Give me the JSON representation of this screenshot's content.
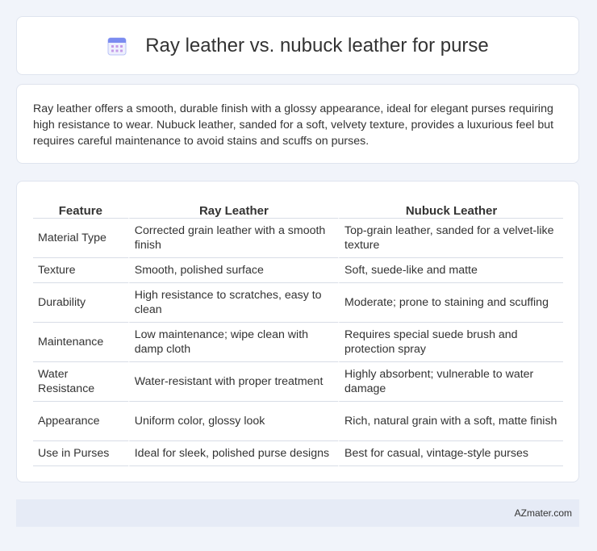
{
  "page": {
    "title": "Ray leather vs. nubuck leather for purse",
    "title_icon": "calendar-icon",
    "summary": "Ray leather offers a smooth, durable finish with a glossy appearance, ideal for elegant purses requiring high resistance to wear. Nubuck leather, sanded for a soft, velvety texture, provides a luxurious feel but requires careful maintenance to avoid stains and scuffs on purses.",
    "footer": "AZmater.com"
  },
  "table": {
    "headers": [
      "Feature",
      "Ray Leather",
      "Nubuck Leather"
    ],
    "rows": [
      [
        "Material Type",
        "Corrected grain leather with a smooth finish",
        "Top-grain leather, sanded for a velvet-like texture"
      ],
      [
        "Texture",
        "Smooth, polished surface",
        "Soft, suede-like and matte"
      ],
      [
        "Durability",
        "High resistance to scratches, easy to clean",
        "Moderate; prone to staining and scuffing"
      ],
      [
        "Maintenance",
        "Low maintenance; wipe clean with damp cloth",
        "Requires special suede brush and protection spray"
      ],
      [
        "Water Resistance",
        "Water-resistant with proper treatment",
        "Highly absorbent; vulnerable to water damage"
      ],
      [
        "Appearance",
        "Uniform color, glossy look",
        "Rich, natural grain with a soft, matte finish"
      ],
      [
        "Use in Purses",
        "Ideal for sleek, polished purse designs",
        "Best for casual, vintage-style purses"
      ]
    ]
  },
  "colors": {
    "background": "#f1f4fa",
    "card": "#ffffff",
    "footer": "#e6ebf6",
    "icon_accent": "#7b8cf0"
  }
}
